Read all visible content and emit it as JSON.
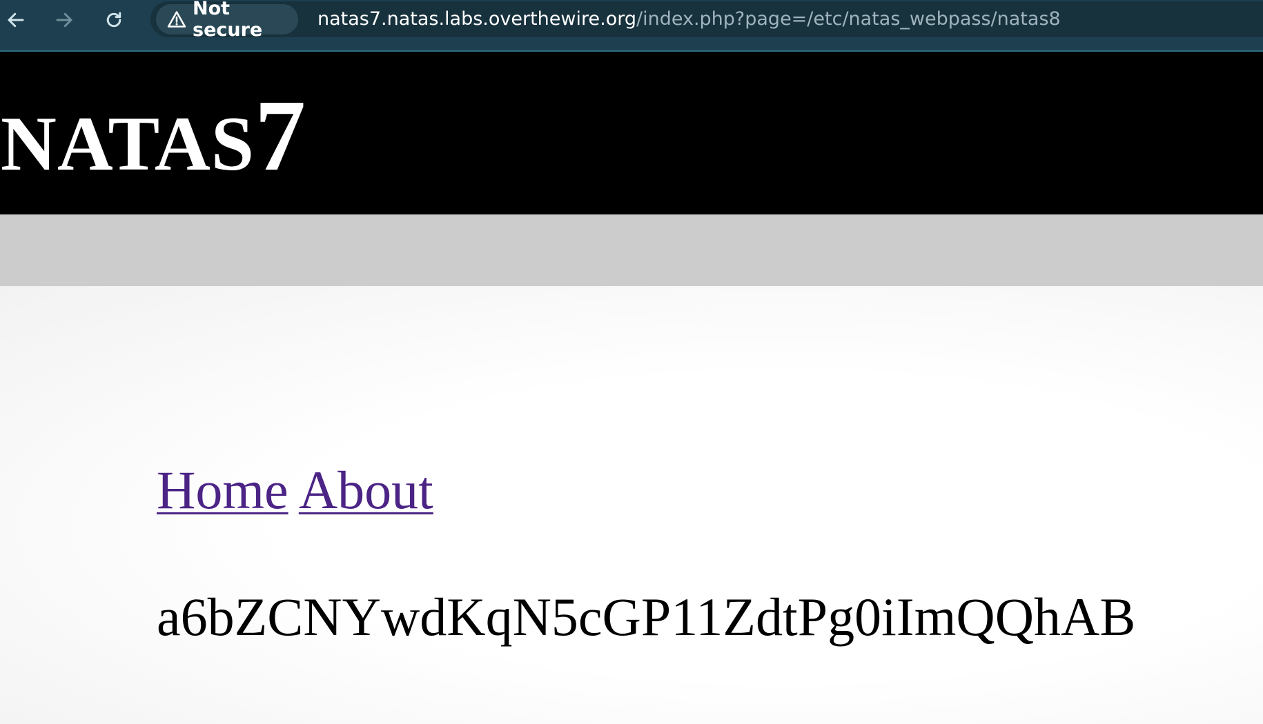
{
  "browser": {
    "security_label": "Not secure",
    "url_host": "natas7.natas.labs.overthewire.org",
    "url_path": "/index.php?page=/etc/natas_webpass/natas8",
    "icons": {
      "back": "arrow-left-icon",
      "forward": "arrow-right-icon",
      "reload": "reload-icon",
      "security": "warning-triangle-icon"
    }
  },
  "page": {
    "title_main": "NATAS",
    "title_number": "7",
    "links": [
      {
        "label": "Home"
      },
      {
        "label": "About"
      }
    ],
    "content_text": "a6bZCNYwdKqN5cGP11ZdtPg0iImQQhAB"
  },
  "colors": {
    "toolbar": "#1d3f4f",
    "omnibox": "#17313d",
    "header_bg": "#000000",
    "band_bg": "#cccccc",
    "link": "#4b2486"
  }
}
